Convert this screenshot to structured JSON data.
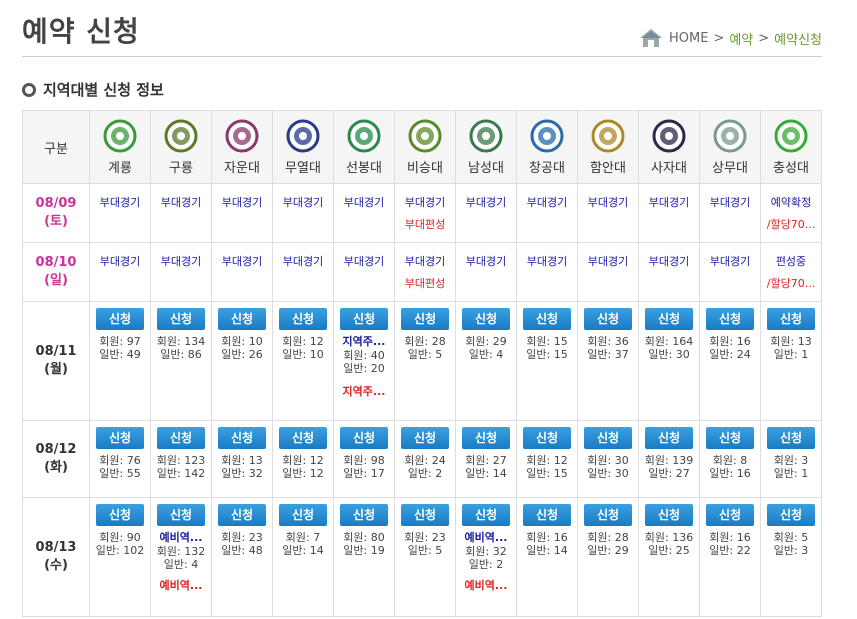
{
  "page": {
    "title": "예약 신청"
  },
  "breadcrumb": {
    "home": "HOME",
    "sep1": ">",
    "level1": "예약",
    "sep2": ">",
    "level2": "예약신청"
  },
  "section": {
    "title": "지역대별 신청 정보"
  },
  "table": {
    "corner": "구분",
    "teams": [
      {
        "name": "계룡",
        "color": "#3a9a3a"
      },
      {
        "name": "구룡",
        "color": "#5a7a2a"
      },
      {
        "name": "자운대",
        "color": "#8a3a6a"
      },
      {
        "name": "무열대",
        "color": "#2a3a8a"
      },
      {
        "name": "선봉대",
        "color": "#2a8a4a"
      },
      {
        "name": "비승대",
        "color": "#5a8a2a"
      },
      {
        "name": "남성대",
        "color": "#3a7a4a"
      },
      {
        "name": "창공대",
        "color": "#2a6aaa"
      },
      {
        "name": "함안대",
        "color": "#aa8a2a"
      },
      {
        "name": "사자대",
        "color": "#2a2a4a"
      },
      {
        "name": "상무대",
        "color": "#7a9a8a"
      },
      {
        "name": "충성대",
        "color": "#3aaa3a"
      }
    ],
    "rows": [
      {
        "date": "08/09",
        "day": "(토)",
        "weekend": true,
        "cells": [
          {
            "type": "game",
            "a": "부대경기"
          },
          {
            "type": "game",
            "a": "부대경기"
          },
          {
            "type": "game",
            "a": "부대경기"
          },
          {
            "type": "game",
            "a": "부대경기"
          },
          {
            "type": "game",
            "a": "부대경기"
          },
          {
            "type": "game",
            "a": "부대경기",
            "b": "부대편성"
          },
          {
            "type": "game",
            "a": "부대경기"
          },
          {
            "type": "game",
            "a": "부대경기"
          },
          {
            "type": "game",
            "a": "부대경기"
          },
          {
            "type": "game",
            "a": "부대경기"
          },
          {
            "type": "game",
            "a": "부대경기"
          },
          {
            "type": "game",
            "a": "예약확정",
            "b": "/할당70..."
          }
        ]
      },
      {
        "date": "08/10",
        "day": "(일)",
        "weekend": true,
        "cells": [
          {
            "type": "game",
            "a": "부대경기"
          },
          {
            "type": "game",
            "a": "부대경기"
          },
          {
            "type": "game",
            "a": "부대경기"
          },
          {
            "type": "game",
            "a": "부대경기"
          },
          {
            "type": "game",
            "a": "부대경기"
          },
          {
            "type": "game",
            "a": "부대경기",
            "b": "부대편성"
          },
          {
            "type": "game",
            "a": "부대경기"
          },
          {
            "type": "game",
            "a": "부대경기"
          },
          {
            "type": "game",
            "a": "부대경기"
          },
          {
            "type": "game",
            "a": "부대경기"
          },
          {
            "type": "game",
            "a": "부대경기"
          },
          {
            "type": "game",
            "a": "편성중",
            "b": "/할당70..."
          }
        ]
      },
      {
        "date": "08/11",
        "day": "(월)",
        "weekend": false,
        "cells": [
          {
            "type": "apply",
            "m": "회원: 97",
            "g": "일반: 49"
          },
          {
            "type": "apply",
            "m": "회원: 134",
            "g": "일반: 86"
          },
          {
            "type": "apply",
            "m": "회원: 10",
            "g": "일반: 26"
          },
          {
            "type": "apply",
            "m": "회원: 12",
            "g": "일반: 10"
          },
          {
            "type": "apply",
            "top": "지역주...",
            "m": "회원: 40",
            "g": "일반: 20",
            "bottom": "지역주..."
          },
          {
            "type": "apply",
            "m": "회원: 28",
            "g": "일반: 5"
          },
          {
            "type": "apply",
            "m": "회원: 29",
            "g": "일반: 4"
          },
          {
            "type": "apply",
            "m": "회원: 15",
            "g": "일반: 15"
          },
          {
            "type": "apply",
            "m": "회원: 36",
            "g": "일반: 37"
          },
          {
            "type": "apply",
            "m": "회원: 164",
            "g": "일반: 30"
          },
          {
            "type": "apply",
            "m": "회원: 16",
            "g": "일반: 24"
          },
          {
            "type": "apply",
            "m": "회원: 13",
            "g": "일반: 1"
          }
        ]
      },
      {
        "date": "08/12",
        "day": "(화)",
        "weekend": false,
        "cells": [
          {
            "type": "apply",
            "m": "회원: 76",
            "g": "일반: 55"
          },
          {
            "type": "apply",
            "m": "회원: 123",
            "g": "일반: 142"
          },
          {
            "type": "apply",
            "m": "회원: 13",
            "g": "일반: 32"
          },
          {
            "type": "apply",
            "m": "회원: 12",
            "g": "일반: 12"
          },
          {
            "type": "apply",
            "m": "회원: 98",
            "g": "일반: 17"
          },
          {
            "type": "apply",
            "m": "회원: 24",
            "g": "일반: 2"
          },
          {
            "type": "apply",
            "m": "회원: 27",
            "g": "일반: 14"
          },
          {
            "type": "apply",
            "m": "회원: 12",
            "g": "일반: 15"
          },
          {
            "type": "apply",
            "m": "회원: 30",
            "g": "일반: 30"
          },
          {
            "type": "apply",
            "m": "회원: 139",
            "g": "일반: 27"
          },
          {
            "type": "apply",
            "m": "회원: 8",
            "g": "일반: 16"
          },
          {
            "type": "apply",
            "m": "회원: 3",
            "g": "일반: 1"
          }
        ]
      },
      {
        "date": "08/13",
        "day": "(수)",
        "weekend": false,
        "cells": [
          {
            "type": "apply",
            "m": "회원: 90",
            "g": "일반: 102"
          },
          {
            "type": "apply",
            "top": "예비역...",
            "m": "회원: 132",
            "g": "일반: 4",
            "bottom": "예비역..."
          },
          {
            "type": "apply",
            "m": "회원: 23",
            "g": "일반: 48"
          },
          {
            "type": "apply",
            "m": "회원: 7",
            "g": "일반: 14"
          },
          {
            "type": "apply",
            "m": "회원: 80",
            "g": "일반: 19"
          },
          {
            "type": "apply",
            "m": "회원: 23",
            "g": "일반: 5"
          },
          {
            "type": "apply",
            "top": "예비역...",
            "m": "회원: 32",
            "g": "일반: 2",
            "bottom": "예비역..."
          },
          {
            "type": "apply",
            "m": "회원: 16",
            "g": "일반: 14"
          },
          {
            "type": "apply",
            "m": "회원: 28",
            "g": "일반: 29"
          },
          {
            "type": "apply",
            "m": "회원: 136",
            "g": "일반: 25"
          },
          {
            "type": "apply",
            "m": "회원: 16",
            "g": "일반: 22"
          },
          {
            "type": "apply",
            "m": "회원: 5",
            "g": "일반: 3"
          }
        ]
      }
    ],
    "apply_label": "신청"
  }
}
